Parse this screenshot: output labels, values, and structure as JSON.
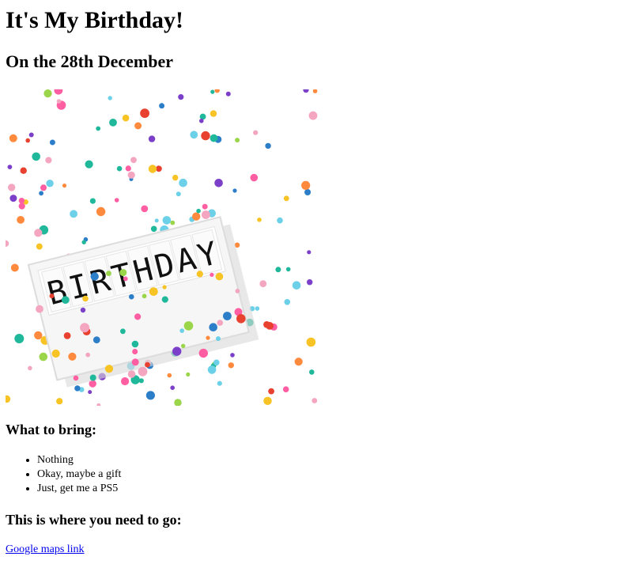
{
  "page": {
    "title": "It's My Birthday!",
    "date_line": "On the 28th December"
  },
  "image": {
    "sign_text": "BIRTHDAY",
    "confetti_colors": [
      "#f4a6c0",
      "#1fb89a",
      "#f7c325",
      "#7c3fc9",
      "#2d7ec9",
      "#e8412f",
      "#ff8a3d",
      "#6bd0e8",
      "#9bd64a",
      "#ff5fa2"
    ]
  },
  "bring": {
    "heading": "What to bring:",
    "items": [
      "Nothing",
      "Okay, maybe a gift",
      "Just, get me a PS5"
    ]
  },
  "location": {
    "heading": "This is where you need to go:",
    "link_text": "Google maps link"
  }
}
